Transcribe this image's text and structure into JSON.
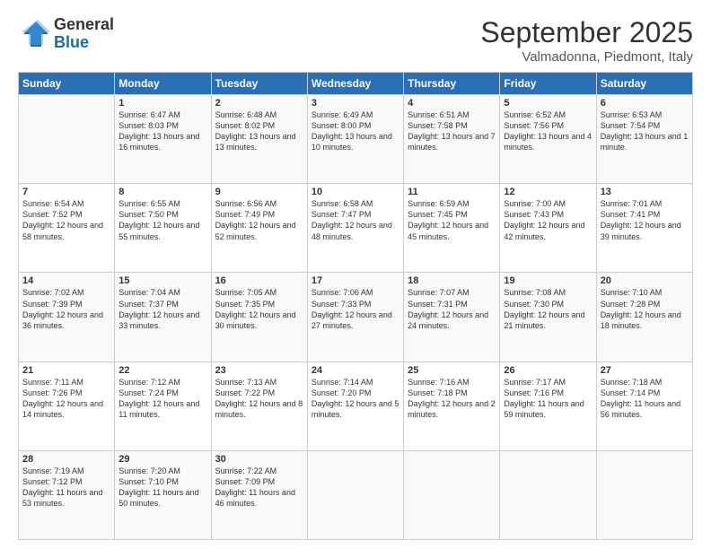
{
  "logo": {
    "general": "General",
    "blue": "Blue"
  },
  "header": {
    "month": "September 2025",
    "location": "Valmadonna, Piedmont, Italy"
  },
  "days_of_week": [
    "Sunday",
    "Monday",
    "Tuesday",
    "Wednesday",
    "Thursday",
    "Friday",
    "Saturday"
  ],
  "weeks": [
    [
      {
        "day": "",
        "sunrise": "",
        "sunset": "",
        "daylight": ""
      },
      {
        "day": "1",
        "sunrise": "Sunrise: 6:47 AM",
        "sunset": "Sunset: 8:03 PM",
        "daylight": "Daylight: 13 hours and 16 minutes."
      },
      {
        "day": "2",
        "sunrise": "Sunrise: 6:48 AM",
        "sunset": "Sunset: 8:02 PM",
        "daylight": "Daylight: 13 hours and 13 minutes."
      },
      {
        "day": "3",
        "sunrise": "Sunrise: 6:49 AM",
        "sunset": "Sunset: 8:00 PM",
        "daylight": "Daylight: 13 hours and 10 minutes."
      },
      {
        "day": "4",
        "sunrise": "Sunrise: 6:51 AM",
        "sunset": "Sunset: 7:58 PM",
        "daylight": "Daylight: 13 hours and 7 minutes."
      },
      {
        "day": "5",
        "sunrise": "Sunrise: 6:52 AM",
        "sunset": "Sunset: 7:56 PM",
        "daylight": "Daylight: 13 hours and 4 minutes."
      },
      {
        "day": "6",
        "sunrise": "Sunrise: 6:53 AM",
        "sunset": "Sunset: 7:54 PM",
        "daylight": "Daylight: 13 hours and 1 minute."
      }
    ],
    [
      {
        "day": "7",
        "sunrise": "Sunrise: 6:54 AM",
        "sunset": "Sunset: 7:52 PM",
        "daylight": "Daylight: 12 hours and 58 minutes."
      },
      {
        "day": "8",
        "sunrise": "Sunrise: 6:55 AM",
        "sunset": "Sunset: 7:50 PM",
        "daylight": "Daylight: 12 hours and 55 minutes."
      },
      {
        "day": "9",
        "sunrise": "Sunrise: 6:56 AM",
        "sunset": "Sunset: 7:49 PM",
        "daylight": "Daylight: 12 hours and 52 minutes."
      },
      {
        "day": "10",
        "sunrise": "Sunrise: 6:58 AM",
        "sunset": "Sunset: 7:47 PM",
        "daylight": "Daylight: 12 hours and 48 minutes."
      },
      {
        "day": "11",
        "sunrise": "Sunrise: 6:59 AM",
        "sunset": "Sunset: 7:45 PM",
        "daylight": "Daylight: 12 hours and 45 minutes."
      },
      {
        "day": "12",
        "sunrise": "Sunrise: 7:00 AM",
        "sunset": "Sunset: 7:43 PM",
        "daylight": "Daylight: 12 hours and 42 minutes."
      },
      {
        "day": "13",
        "sunrise": "Sunrise: 7:01 AM",
        "sunset": "Sunset: 7:41 PM",
        "daylight": "Daylight: 12 hours and 39 minutes."
      }
    ],
    [
      {
        "day": "14",
        "sunrise": "Sunrise: 7:02 AM",
        "sunset": "Sunset: 7:39 PM",
        "daylight": "Daylight: 12 hours and 36 minutes."
      },
      {
        "day": "15",
        "sunrise": "Sunrise: 7:04 AM",
        "sunset": "Sunset: 7:37 PM",
        "daylight": "Daylight: 12 hours and 33 minutes."
      },
      {
        "day": "16",
        "sunrise": "Sunrise: 7:05 AM",
        "sunset": "Sunset: 7:35 PM",
        "daylight": "Daylight: 12 hours and 30 minutes."
      },
      {
        "day": "17",
        "sunrise": "Sunrise: 7:06 AM",
        "sunset": "Sunset: 7:33 PM",
        "daylight": "Daylight: 12 hours and 27 minutes."
      },
      {
        "day": "18",
        "sunrise": "Sunrise: 7:07 AM",
        "sunset": "Sunset: 7:31 PM",
        "daylight": "Daylight: 12 hours and 24 minutes."
      },
      {
        "day": "19",
        "sunrise": "Sunrise: 7:08 AM",
        "sunset": "Sunset: 7:30 PM",
        "daylight": "Daylight: 12 hours and 21 minutes."
      },
      {
        "day": "20",
        "sunrise": "Sunrise: 7:10 AM",
        "sunset": "Sunset: 7:28 PM",
        "daylight": "Daylight: 12 hours and 18 minutes."
      }
    ],
    [
      {
        "day": "21",
        "sunrise": "Sunrise: 7:11 AM",
        "sunset": "Sunset: 7:26 PM",
        "daylight": "Daylight: 12 hours and 14 minutes."
      },
      {
        "day": "22",
        "sunrise": "Sunrise: 7:12 AM",
        "sunset": "Sunset: 7:24 PM",
        "daylight": "Daylight: 12 hours and 11 minutes."
      },
      {
        "day": "23",
        "sunrise": "Sunrise: 7:13 AM",
        "sunset": "Sunset: 7:22 PM",
        "daylight": "Daylight: 12 hours and 8 minutes."
      },
      {
        "day": "24",
        "sunrise": "Sunrise: 7:14 AM",
        "sunset": "Sunset: 7:20 PM",
        "daylight": "Daylight: 12 hours and 5 minutes."
      },
      {
        "day": "25",
        "sunrise": "Sunrise: 7:16 AM",
        "sunset": "Sunset: 7:18 PM",
        "daylight": "Daylight: 12 hours and 2 minutes."
      },
      {
        "day": "26",
        "sunrise": "Sunrise: 7:17 AM",
        "sunset": "Sunset: 7:16 PM",
        "daylight": "Daylight: 11 hours and 59 minutes."
      },
      {
        "day": "27",
        "sunrise": "Sunrise: 7:18 AM",
        "sunset": "Sunset: 7:14 PM",
        "daylight": "Daylight: 11 hours and 56 minutes."
      }
    ],
    [
      {
        "day": "28",
        "sunrise": "Sunrise: 7:19 AM",
        "sunset": "Sunset: 7:12 PM",
        "daylight": "Daylight: 11 hours and 53 minutes."
      },
      {
        "day": "29",
        "sunrise": "Sunrise: 7:20 AM",
        "sunset": "Sunset: 7:10 PM",
        "daylight": "Daylight: 11 hours and 50 minutes."
      },
      {
        "day": "30",
        "sunrise": "Sunrise: 7:22 AM",
        "sunset": "Sunset: 7:09 PM",
        "daylight": "Daylight: 11 hours and 46 minutes."
      },
      {
        "day": "",
        "sunrise": "",
        "sunset": "",
        "daylight": ""
      },
      {
        "day": "",
        "sunrise": "",
        "sunset": "",
        "daylight": ""
      },
      {
        "day": "",
        "sunrise": "",
        "sunset": "",
        "daylight": ""
      },
      {
        "day": "",
        "sunrise": "",
        "sunset": "",
        "daylight": ""
      }
    ]
  ]
}
